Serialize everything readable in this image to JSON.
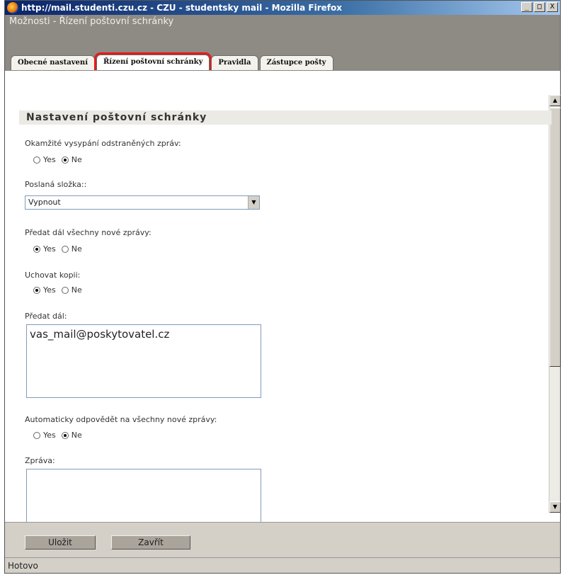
{
  "window": {
    "title": "http://mail.studenti.czu.cz - CZU - studentsky mail - Mozilla Firefox",
    "buttons": {
      "minimize": "_",
      "maximize": "□",
      "close": "X"
    }
  },
  "page": {
    "title": "Možnosti - Řízení poštovní schránky",
    "tabs": [
      {
        "label": "Obecné nastavení"
      },
      {
        "label": "Řízení poštovní schránky",
        "active": true
      },
      {
        "label": "Pravidla"
      },
      {
        "label": "Zástupce pošty"
      }
    ]
  },
  "section": {
    "title": "Nastavení poštovní schránky"
  },
  "form": {
    "purge": {
      "label": "Okamžité vysypání odstraněných zpráv:",
      "yes": "Yes",
      "no": "Ne",
      "selected": "no"
    },
    "sent_folder": {
      "label": "Poslaná složka::",
      "value": "Vypnout"
    },
    "forward_all": {
      "label": "Předat dál všechny nové zprávy:",
      "yes": "Yes",
      "no": "Ne",
      "selected": "yes"
    },
    "keep_copy": {
      "label": "Uchovat kopii:",
      "yes": "Yes",
      "no": "Ne",
      "selected": "yes"
    },
    "forward_to": {
      "label": "Předat dál:",
      "value": "vas_mail@poskytovatel.cz"
    },
    "auto_reply": {
      "label": "Automaticky odpovědět na všechny nové zprávy:",
      "yes": "Yes",
      "no": "Ne",
      "selected": "no"
    },
    "message": {
      "label": "Zpráva:",
      "value": ""
    }
  },
  "footer": {
    "save": "Uložit",
    "close": "Zavřít"
  },
  "status": "Hotovo",
  "colors": {
    "highlight": "#e31b1b",
    "titlebar": "#0a246a",
    "header": "#8e8a84"
  }
}
